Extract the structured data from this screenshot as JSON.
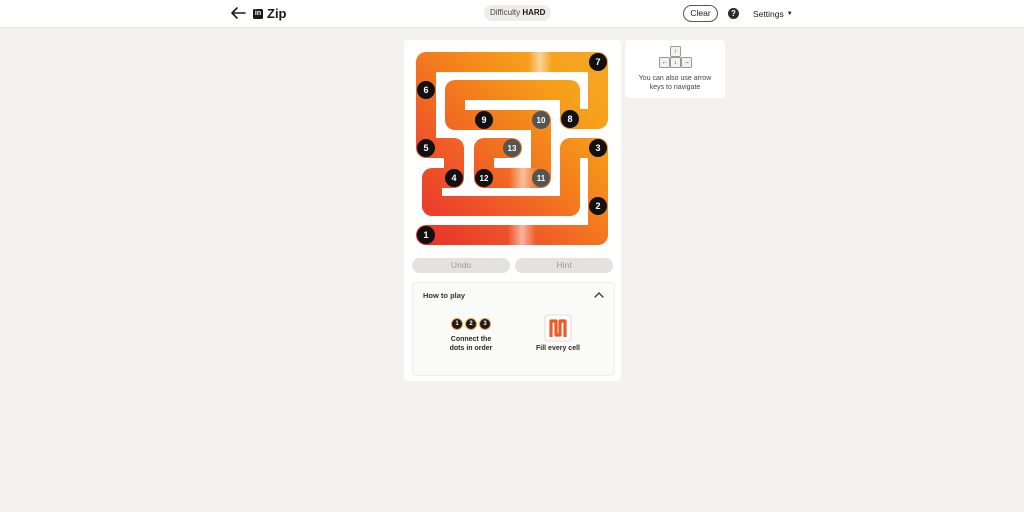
{
  "header": {
    "brand": "Zip",
    "logo_text": "in",
    "difficulty_label": "Difficulty",
    "difficulty_value": "HARD",
    "clear_label": "Clear",
    "help_label": "?",
    "settings_label": "Settings"
  },
  "board": {
    "path_colors": [
      "#e8352c",
      "#f05a28",
      "#f47f1c",
      "#f6a01a",
      "#f5a623"
    ],
    "numbers": [
      "1",
      "2",
      "3",
      "4",
      "5",
      "6",
      "7",
      "8",
      "9",
      "10",
      "11",
      "12",
      "13"
    ]
  },
  "controls": {
    "undo_label": "Undo",
    "hint_label": "Hint"
  },
  "howto": {
    "title": "How to play",
    "tip1_dots": [
      "1",
      "2",
      "3"
    ],
    "tip1_line1": "Connect the",
    "tip1_line2": "dots in order",
    "tip2_text": "Fill every cell"
  },
  "side": {
    "text_line1": "You can also use arrow",
    "text_line2": "keys to navigate",
    "keys": {
      "up": "↑",
      "left": "←",
      "down": "↓",
      "right": "→"
    }
  }
}
